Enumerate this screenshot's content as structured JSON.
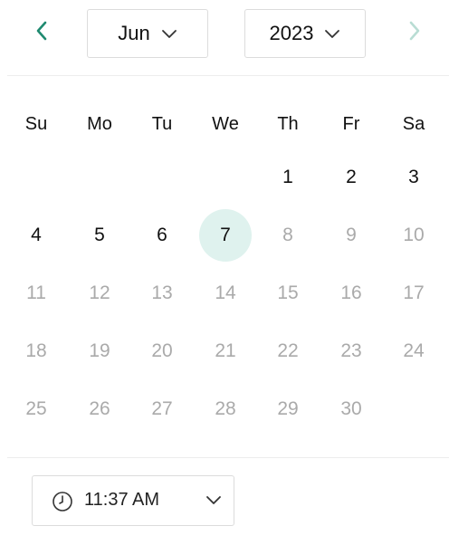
{
  "header": {
    "prev_icon": "chevron-left-icon",
    "next_icon": "chevron-right-icon",
    "month": "Jun",
    "year": "2023",
    "caret_icon": "chevron-down-icon"
  },
  "weekdays": [
    "Su",
    "Mo",
    "Tu",
    "We",
    "Th",
    "Fr",
    "Sa"
  ],
  "days": [
    {
      "label": "1",
      "state": "active"
    },
    {
      "label": "2",
      "state": "active"
    },
    {
      "label": "3",
      "state": "active"
    },
    {
      "label": "4",
      "state": "active"
    },
    {
      "label": "5",
      "state": "active"
    },
    {
      "label": "6",
      "state": "active"
    },
    {
      "label": "7",
      "state": "selected"
    },
    {
      "label": "8",
      "state": "disabled"
    },
    {
      "label": "9",
      "state": "disabled"
    },
    {
      "label": "10",
      "state": "disabled"
    },
    {
      "label": "11",
      "state": "disabled"
    },
    {
      "label": "12",
      "state": "disabled"
    },
    {
      "label": "13",
      "state": "disabled"
    },
    {
      "label": "14",
      "state": "disabled"
    },
    {
      "label": "15",
      "state": "disabled"
    },
    {
      "label": "16",
      "state": "disabled"
    },
    {
      "label": "17",
      "state": "disabled"
    },
    {
      "label": "18",
      "state": "disabled"
    },
    {
      "label": "19",
      "state": "disabled"
    },
    {
      "label": "20",
      "state": "disabled"
    },
    {
      "label": "21",
      "state": "disabled"
    },
    {
      "label": "22",
      "state": "disabled"
    },
    {
      "label": "23",
      "state": "disabled"
    },
    {
      "label": "24",
      "state": "disabled"
    },
    {
      "label": "25",
      "state": "disabled"
    },
    {
      "label": "26",
      "state": "disabled"
    },
    {
      "label": "27",
      "state": "disabled"
    },
    {
      "label": "28",
      "state": "disabled"
    },
    {
      "label": "29",
      "state": "disabled"
    },
    {
      "label": "30",
      "state": "disabled"
    }
  ],
  "time": {
    "value": "11:37 AM",
    "clock_icon": "clock-icon",
    "caret_icon": "chevron-down-icon"
  },
  "colors": {
    "accent": "#1f8a70",
    "accent_disabled": "#b9ddd4",
    "selected_bg": "#dff2ee",
    "disabled_text": "#aaaaaa",
    "border": "#dcdcdc"
  }
}
